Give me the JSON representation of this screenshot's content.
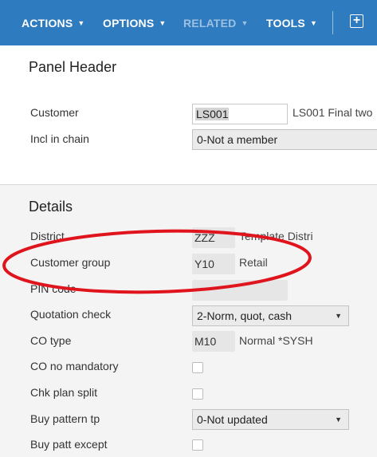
{
  "toolbar": {
    "actions": "ACTIONS",
    "options": "OPTIONS",
    "related": "RELATED",
    "tools": "TOOLS",
    "caret": "▼",
    "add": "+"
  },
  "panel_header": {
    "title": "Panel Header",
    "customer_label": "Customer",
    "customer_value": "LS001",
    "customer_desc": "LS001 Final two",
    "chain_label": "Incl in chain",
    "chain_value": "0-Not a member"
  },
  "details": {
    "title": "Details",
    "district_label": "District",
    "district_value": "ZZZ",
    "district_desc": "Template Distri",
    "group_label": "Customer group",
    "group_value": "Y10",
    "group_desc": "Retail",
    "pin_label": "PIN code",
    "quot_label": "Quotation check",
    "quot_value": "2-Norm, quot, cash",
    "co_type_label": "CO type",
    "co_type_value": "M10",
    "co_type_desc": "Normal *SYSH",
    "co_no_mand_label": "CO no mandatory",
    "chk_plan_label": "Chk plan split",
    "buy_pattern_label": "Buy pattern tp",
    "buy_pattern_value": "0-Not updated",
    "buy_patt_except_label": "Buy patt except"
  },
  "colors": {
    "toolbar": "#2f7bbf",
    "highlight_oval": "#e0141c"
  }
}
